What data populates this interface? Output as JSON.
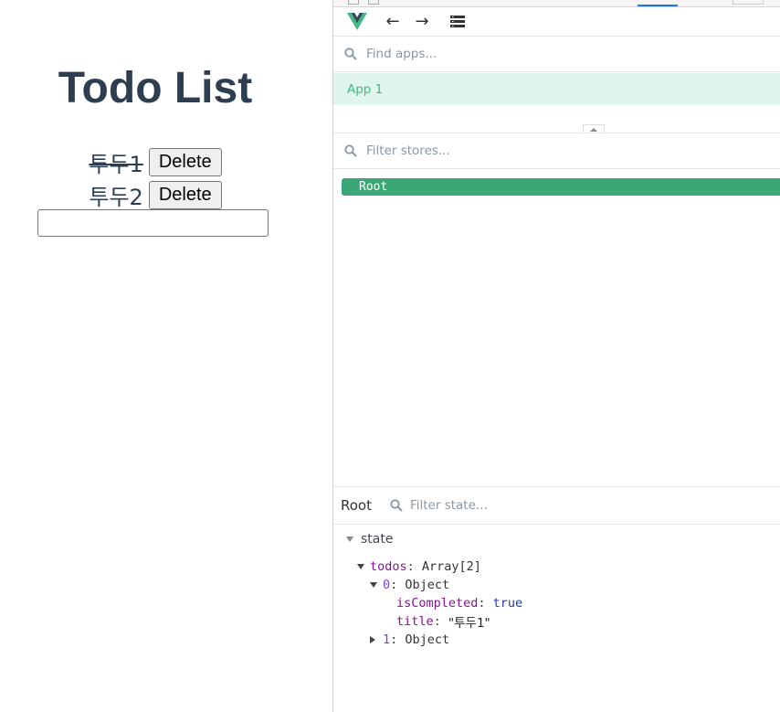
{
  "app": {
    "title": "Todo List",
    "todos": [
      {
        "title": "투두1",
        "completed": true,
        "delete_label": "Delete"
      },
      {
        "title": "투두2",
        "completed": false,
        "delete_label": "Delete"
      }
    ],
    "new_todo_value": ""
  },
  "devtools": {
    "toolbar": {
      "logo": "vue-logo-icon",
      "back": "←",
      "forward": "→",
      "menu": "list-icon"
    },
    "find_apps_placeholder": "Find apps...",
    "apps": [
      {
        "label": "App 1",
        "selected": true
      }
    ],
    "filter_stores_placeholder": "Filter stores...",
    "stores": [
      {
        "label": "Root",
        "selected": true
      }
    ],
    "inspector": {
      "store_label": "Root",
      "filter_state_placeholder": "Filter state...",
      "section": "state",
      "tree": {
        "todos_key": "todos",
        "todos_type": "Array[2]",
        "item0_key": "0",
        "item0_type": "Object",
        "isCompleted_key": "isCompleted",
        "isCompleted_value": "true",
        "title_key": "title",
        "title_value": "\"투두1\"",
        "item1_key": "1",
        "item1_type": "Object"
      }
    },
    "colors": {
      "accent": "#42b983",
      "selected_store": "#3ba776",
      "app_bg": "#e0f5ec"
    }
  }
}
